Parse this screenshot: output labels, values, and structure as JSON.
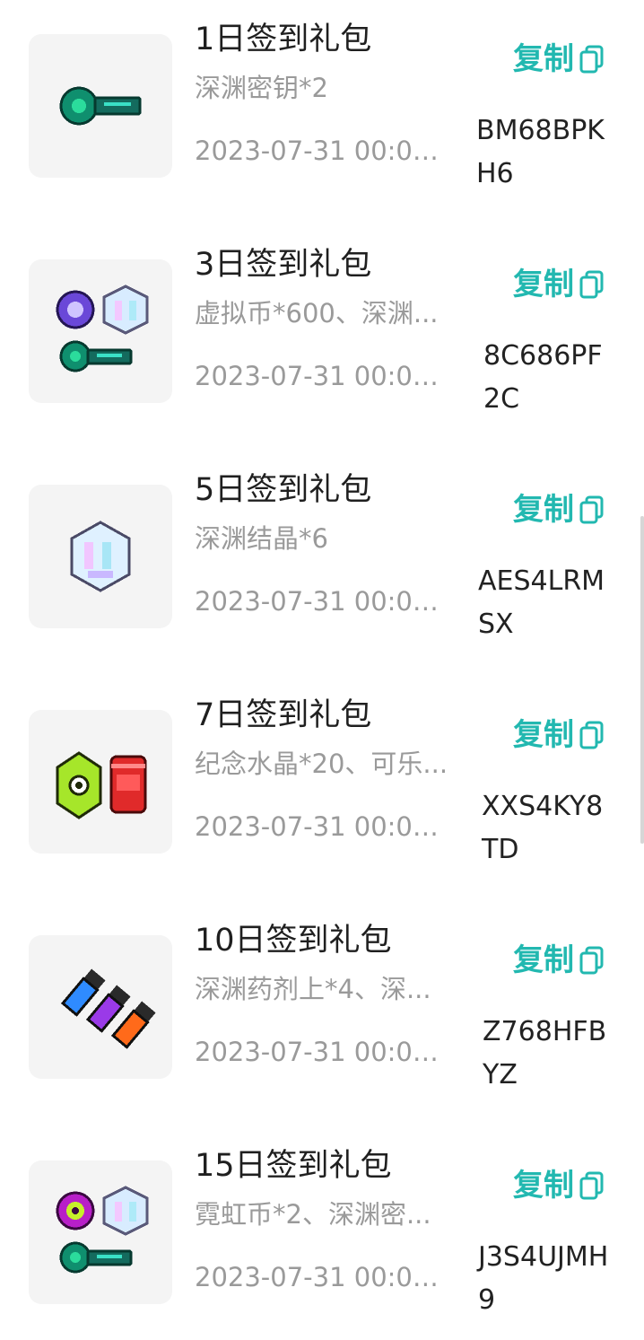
{
  "copy_label": "复制",
  "gifts": [
    {
      "title": "1日签到礼包",
      "desc": "深渊密钥*2",
      "date": "2023-07-31 00:00 ...",
      "code": "BM68BPKH6"
    },
    {
      "title": "3日签到礼包",
      "desc": "虚拟币*600、深渊...",
      "date": "2023-07-31 00:00 ...",
      "code": "8C686PF2C"
    },
    {
      "title": "5日签到礼包",
      "desc": "深渊结晶*6",
      "date": "2023-07-31 00:00 ...",
      "code": "AES4LRMSX"
    },
    {
      "title": "7日签到礼包",
      "desc": "纪念水晶*20、可乐...",
      "date": "2023-07-31 00:00 ...",
      "code": "XXS4KY8TD"
    },
    {
      "title": "10日签到礼包",
      "desc": "深渊药剂上*4、深...",
      "date": "2023-07-31 00:00 ...",
      "code": "Z768HFBYZ"
    },
    {
      "title": "15日签到礼包",
      "desc": "霓虹币*2、深渊密...",
      "date": "2023-07-31 00:00 ...",
      "code": "J3S4UJMH9"
    }
  ],
  "colors": {
    "accent": "#22b8b0",
    "title": "#1f1f1f",
    "secondary": "#9a9a9a",
    "thumb_bg": "#f4f4f4"
  },
  "icons": [
    "key-icon",
    "coin-icon",
    "crystal-icon",
    "gem-icon",
    "cola-icon",
    "potion-icon",
    "neon-coin-icon",
    "copy-icon"
  ]
}
